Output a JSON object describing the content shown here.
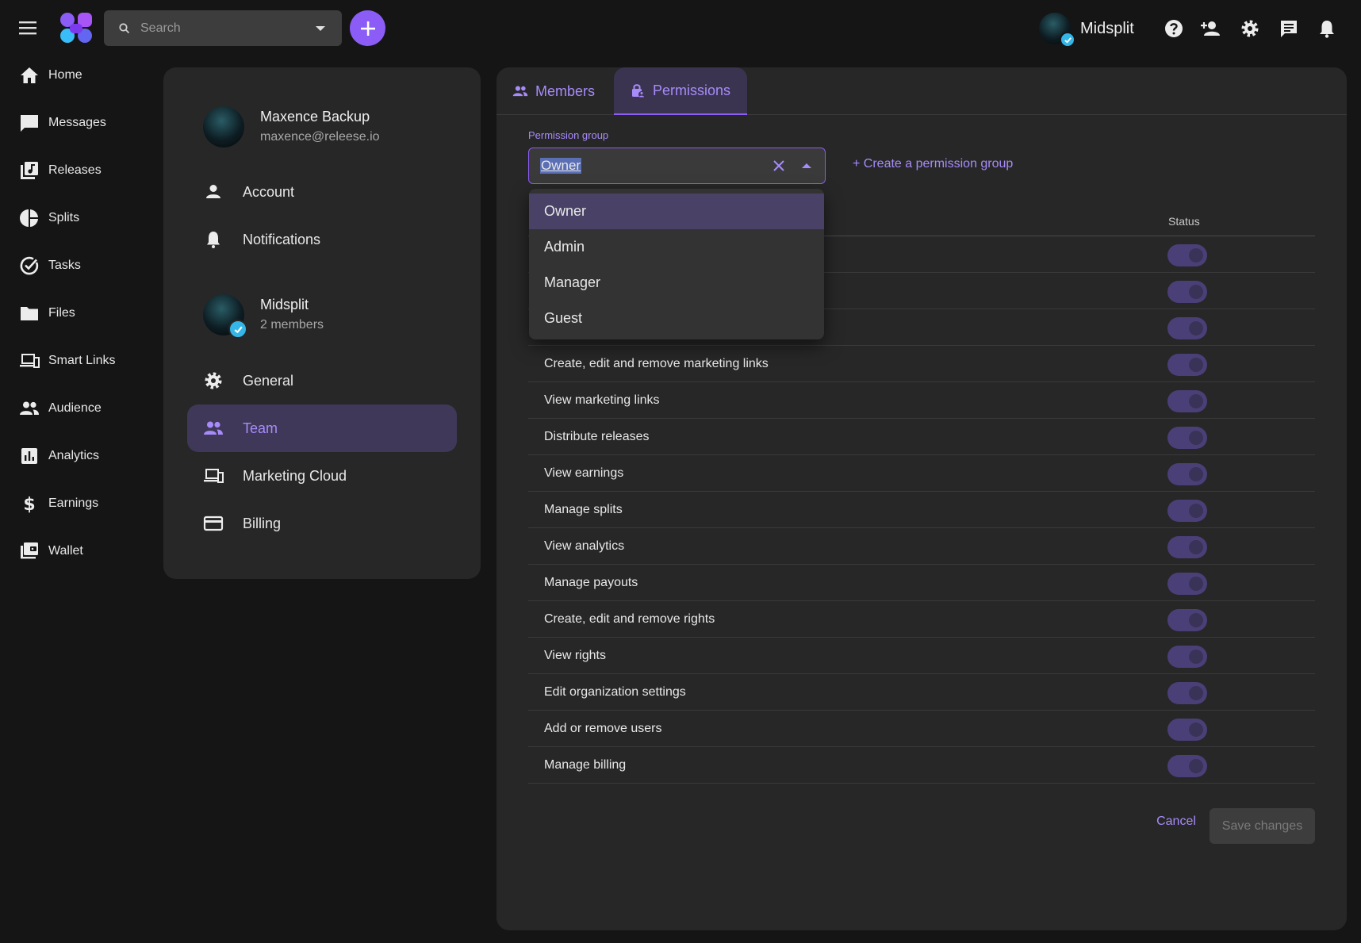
{
  "search": {
    "placeholder": "Search"
  },
  "org": {
    "name": "Midsplit"
  },
  "nav": {
    "items": [
      {
        "label": "Home",
        "icon": "home-icon"
      },
      {
        "label": "Messages",
        "icon": "chat-icon"
      },
      {
        "label": "Releases",
        "icon": "library-music-icon"
      },
      {
        "label": "Splits",
        "icon": "pie-chart-icon"
      },
      {
        "label": "Tasks",
        "icon": "check-circle-icon"
      },
      {
        "label": "Files",
        "icon": "folder-icon"
      },
      {
        "label": "Smart Links",
        "icon": "devices-icon"
      },
      {
        "label": "Audience",
        "icon": "people-icon"
      },
      {
        "label": "Analytics",
        "icon": "bar-chart-icon"
      },
      {
        "label": "Earnings",
        "icon": "dollar-icon"
      },
      {
        "label": "Wallet",
        "icon": "wallet-icon"
      }
    ]
  },
  "settings": {
    "user": {
      "name": "Maxence Backup",
      "email": "maxence@releese.io"
    },
    "user_items": [
      {
        "label": "Account",
        "icon": "person-icon"
      },
      {
        "label": "Notifications",
        "icon": "bell-icon"
      }
    ],
    "org": {
      "name": "Midsplit",
      "members": "2 members"
    },
    "org_items": [
      {
        "label": "General",
        "icon": "gear-icon"
      },
      {
        "label": "Team",
        "icon": "people-icon",
        "active": true
      },
      {
        "label": "Marketing Cloud",
        "icon": "devices-icon"
      },
      {
        "label": "Billing",
        "icon": "credit-card-icon"
      }
    ]
  },
  "tabs": [
    {
      "label": "Members",
      "icon": "people-icon"
    },
    {
      "label": "Permissions",
      "icon": "lock-person-icon",
      "active": true
    }
  ],
  "permission_group": {
    "label": "Permission group",
    "value": "Owner",
    "create_link": "+ Create a permission group",
    "options": [
      "Owner",
      "Admin",
      "Manager",
      "Guest"
    ]
  },
  "table": {
    "status_header": "Status",
    "rows": [
      {
        "label": "",
        "enabled": true
      },
      {
        "label": "",
        "enabled": true
      },
      {
        "label": "",
        "enabled": true
      },
      {
        "label": "Create, edit and remove marketing links",
        "enabled": true
      },
      {
        "label": "View marketing links",
        "enabled": true
      },
      {
        "label": "Distribute releases",
        "enabled": true
      },
      {
        "label": "View earnings",
        "enabled": true
      },
      {
        "label": "Manage splits",
        "enabled": true
      },
      {
        "label": "View analytics",
        "enabled": true
      },
      {
        "label": "Manage payouts",
        "enabled": true
      },
      {
        "label": "Create, edit and remove rights",
        "enabled": true
      },
      {
        "label": "View rights",
        "enabled": true
      },
      {
        "label": "Edit organization settings",
        "enabled": true
      },
      {
        "label": "Add or remove users",
        "enabled": true
      },
      {
        "label": "Manage billing",
        "enabled": true
      }
    ]
  },
  "actions": {
    "cancel": "Cancel",
    "save": "Save changes"
  },
  "colors": {
    "accent": "#8b5cf6",
    "accent_text": "#a78bfa",
    "verified": "#35b6e8"
  }
}
